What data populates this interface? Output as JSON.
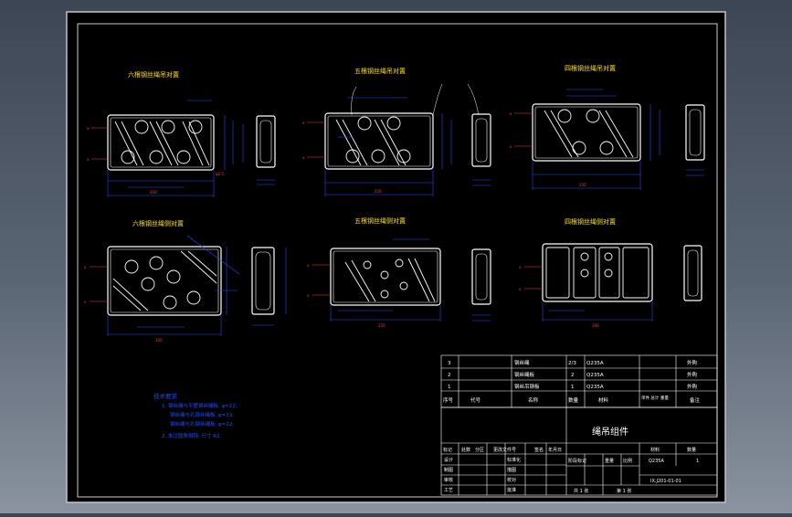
{
  "colors": {
    "background": "#4b5563",
    "sheet": "#000000",
    "sheet_border": "#ffffff",
    "drawing_line": "#ffffff",
    "dimension": "#1f4cff",
    "annotation": "#ff3b30",
    "title_text": "#ffe21a",
    "table_text": "#ffffff"
  },
  "views": {
    "v1": {
      "title": "六根钢丝绳吊对置"
    },
    "v2": {
      "title": "五根钢丝绳吊对置"
    },
    "v3": {
      "title": "四根钢丝绳吊对置"
    },
    "v4": {
      "title": "六根钢丝绳侧对置"
    },
    "v5": {
      "title": "五根钢丝绳侧对置"
    },
    "v6": {
      "title": "四根钢丝绳侧对置"
    }
  },
  "notes": {
    "heading": "技术要求",
    "lines": [
      "1. 钢丝绳与平整钢丝绳板, φ=22;",
      "钢丝绳与孔钢丝绳板, φ=22;",
      "钢丝绳与孔钢丝绳板, φ=22;",
      "2. 未注圆角倒钝, 尺寸 R2."
    ]
  },
  "parts_list": {
    "rows": [
      {
        "no": "3",
        "code": "",
        "name": "钢丝绳",
        "qty": "2/3",
        "material": "Q235A",
        "weight": "",
        "note": "外购"
      },
      {
        "no": "2",
        "code": "",
        "name": "钢丝绳板",
        "qty": "2",
        "material": "Q235A",
        "weight": "",
        "note": "外购"
      },
      {
        "no": "1",
        "code": "",
        "name": "钢丝吊钢板",
        "qty": "1",
        "material": "Q235A",
        "weight": "",
        "note": "外购"
      }
    ],
    "header": {
      "no": "序号",
      "code": "代号",
      "name": "名称",
      "qty": "数量",
      "material": "材料",
      "weight": "单件 总计 重量",
      "note": "备注"
    }
  },
  "title_block": {
    "drawing_title": "绳吊组件",
    "material_label": "材料",
    "material_value": "Q235A",
    "scale_label": "数量",
    "scale_value": "1",
    "code": "IX.J201-01-01",
    "sheets": "共 1 张",
    "sheet_no": "第 1 张",
    "rev_headers": [
      "标记",
      "处数",
      "分区",
      "更改文件号",
      "签名",
      "年月日"
    ],
    "stage_headers": [
      "阶段标记",
      "重量",
      "比例"
    ],
    "roles": [
      "设计",
      "制图",
      "审核",
      "工艺"
    ],
    "role2": [
      "标准化",
      "描图",
      "校对",
      "批准"
    ]
  }
}
